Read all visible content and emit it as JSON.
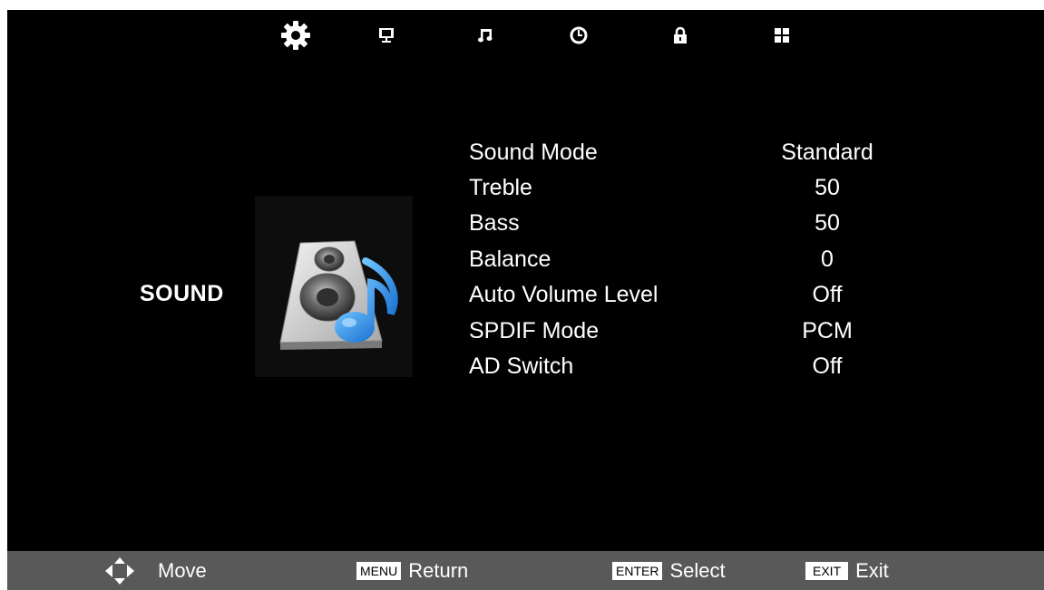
{
  "top_tabs": [
    {
      "id": "picture-settings",
      "icon": "gear-icon"
    },
    {
      "id": "display",
      "icon": "monitor-icon"
    },
    {
      "id": "sound",
      "icon": "music-note-icon"
    },
    {
      "id": "time",
      "icon": "clock-icon"
    },
    {
      "id": "lock",
      "icon": "lock-icon"
    },
    {
      "id": "setup",
      "icon": "grid-icon"
    }
  ],
  "section": {
    "title": "SOUND",
    "image": "speaker-music-icon"
  },
  "menu": [
    {
      "label": "Sound Mode",
      "value": "Standard"
    },
    {
      "label": "Treble",
      "value": "50"
    },
    {
      "label": "Bass",
      "value": "50"
    },
    {
      "label": "Balance",
      "value": "0"
    },
    {
      "label": "Auto Volume Level",
      "value": "Off"
    },
    {
      "label": "SPDIF Mode",
      "value": "PCM"
    },
    {
      "label": "AD Switch",
      "value": "Off"
    }
  ],
  "footer": {
    "move": {
      "label": "Move",
      "icon": "arrow-pad-icon"
    },
    "return": {
      "key": "MENU",
      "label": "Return"
    },
    "select": {
      "key": "ENTER",
      "label": "Select"
    },
    "exit": {
      "key": "EXIT",
      "label": "Exit"
    }
  },
  "colors": {
    "background": "#000000",
    "footer": "#595959",
    "text": "#ffffff",
    "accent_blue": "#2e8fe0"
  }
}
